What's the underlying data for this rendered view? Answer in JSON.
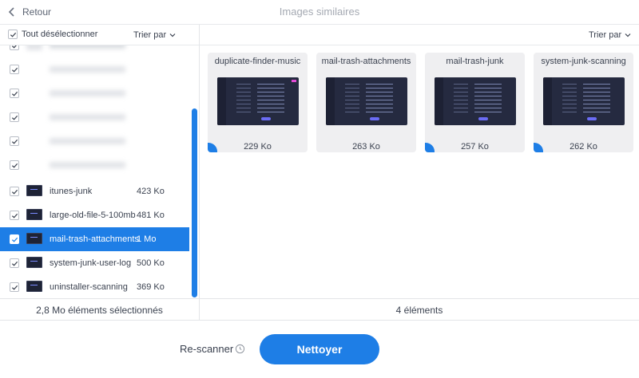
{
  "header": {
    "back_label": "Retour",
    "title": "Images similaires"
  },
  "toolbar": {
    "select_all_label": "Tout désélectionner",
    "sort_left_label": "Trier par",
    "sort_right_label": "Trier par"
  },
  "list": {
    "items": [
      {
        "name": "itunes-junk",
        "size": "423 Ko"
      },
      {
        "name": "large-old-file-5-100mb",
        "size": "481 Ko"
      },
      {
        "name": "mail-trash-attachments",
        "size": "1 Mo"
      },
      {
        "name": "system-junk-user-log",
        "size": "500 Ko"
      },
      {
        "name": "uninstaller-scanning",
        "size": "369 Ko"
      }
    ]
  },
  "cards": [
    {
      "name": "duplicate-finder-music",
      "size": "229 Ko"
    },
    {
      "name": "mail-trash-attachments",
      "size": "263 Ko"
    },
    {
      "name": "mail-trash-junk",
      "size": "257 Ko"
    },
    {
      "name": "system-junk-scanning",
      "size": "262 Ko"
    }
  ],
  "status": {
    "selected_text": "2,8 Mo éléments sélectionnés",
    "count_text": "4 éléments"
  },
  "actions": {
    "rescan_label": "Re-scanner",
    "clean_label": "Nettoyer"
  },
  "colors": {
    "accent": "#1e7ee6",
    "screen_bg": "#252a40",
    "card_bg": "#efeff1"
  }
}
